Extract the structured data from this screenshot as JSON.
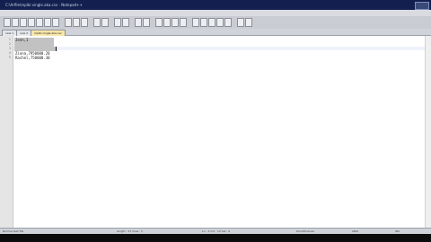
{
  "window": {
    "title": "C:\\Arfile\\mplkr.vingle.aka.csv - Notepad++"
  },
  "tabs": [
    {
      "label": "new  1"
    },
    {
      "label": "new  2"
    },
    {
      "label": "mplkr.vingle.aka.csv"
    }
  ],
  "editor": {
    "lines": [
      {
        "num": "1",
        "text": "Jenn,1"
      },
      {
        "num": "2",
        "text": ""
      },
      {
        "num": "3",
        "text": ""
      },
      {
        "num": "4",
        "text": "Ziona,7950000.20"
      },
      {
        "num": "5",
        "text": "Rachel,750000.30"
      }
    ]
  },
  "statusbar": {
    "type": "Normal text file",
    "length": "length : 97    lines : 5",
    "position": "Ln : 3    Col : 12    Sel : 0",
    "eol": "Dos\\Windows",
    "encoding": "ANSI",
    "mode": "INS"
  }
}
